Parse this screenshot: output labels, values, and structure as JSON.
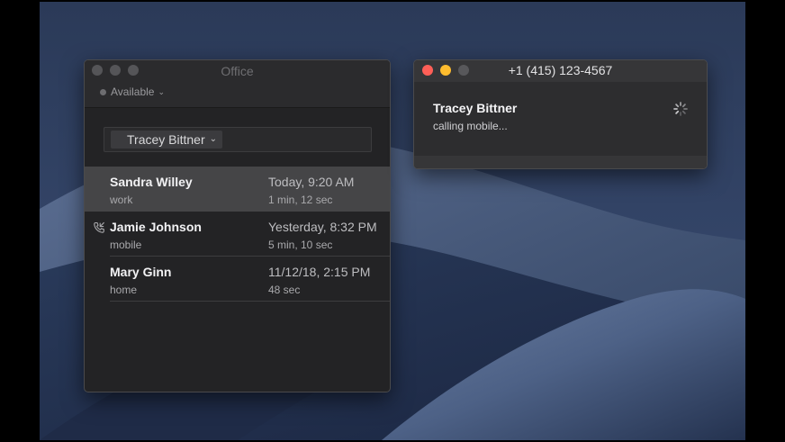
{
  "office_window": {
    "title": "Office",
    "status": "Available",
    "contact_token": "Tracey Bittner",
    "calls": [
      {
        "name": "Sandra Willey",
        "type": "work",
        "time": "Today, 9:20 AM",
        "duration": "1 min, 12 sec",
        "selected": true,
        "icon": ""
      },
      {
        "name": "Jamie Johnson",
        "type": "mobile",
        "time": "Yesterday, 8:32 PM",
        "duration": "5 min, 10 sec",
        "selected": false,
        "icon": "phone-incoming-icon"
      },
      {
        "name": "Mary Ginn",
        "type": "home",
        "time": "11/12/18, 2:15 PM",
        "duration": "48 sec",
        "selected": false,
        "icon": ""
      }
    ]
  },
  "calling_window": {
    "title": "+1 (415) 123-4567",
    "caller_name": "Tracey Bittner",
    "caller_status": "calling mobile..."
  },
  "colors": {
    "close": "#ff5f57",
    "minimize": "#febc2e",
    "inactive": "#555558",
    "selected_row": "#454547"
  }
}
